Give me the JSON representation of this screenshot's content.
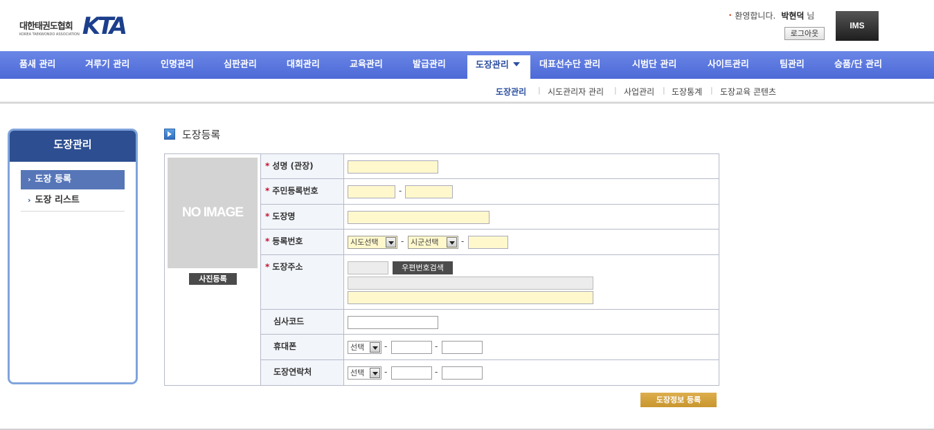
{
  "header": {
    "logo_kr": "대한태권도협회",
    "logo_en": "KOREA TAEKWONDO ASSOCIATION",
    "logo_mark": "KTA",
    "welcome": "환영합니다.",
    "user_name": "박현덕",
    "user_suffix": "님",
    "logout_label": "로그아웃",
    "ims_label": "IMS"
  },
  "main_nav": [
    {
      "label": "품새 관리"
    },
    {
      "label": "겨루기 관리"
    },
    {
      "label": "인명관리"
    },
    {
      "label": "심판관리"
    },
    {
      "label": "대회관리"
    },
    {
      "label": "교육관리"
    },
    {
      "label": "발급관리"
    },
    {
      "label": "도장관리"
    },
    {
      "label": "대표선수단 관리"
    },
    {
      "label": "시범단 관리"
    },
    {
      "label": "사이트관리"
    },
    {
      "label": "팀관리"
    },
    {
      "label": "승품/단 관리"
    }
  ],
  "sub_nav": [
    {
      "label": "도장관리"
    },
    {
      "label": "시도관리자 관리"
    },
    {
      "label": "사업관리"
    },
    {
      "label": "도장통계"
    },
    {
      "label": "도장교육 콘텐츠"
    }
  ],
  "side": {
    "title": "도장관리",
    "items": [
      {
        "label": "도장 등록"
      },
      {
        "label": "도장 리스트"
      }
    ]
  },
  "section_title": "도장등록",
  "form": {
    "photo_placeholder": "NO IMAGE",
    "photo_button": "사진등록",
    "required_mark": "*",
    "rows": {
      "name": {
        "label": "성명 (관장)"
      },
      "rrn": {
        "label": "주민등록번호"
      },
      "dojang_name": {
        "label": "도장명"
      },
      "reg_no": {
        "label": "등록번호",
        "sido": "시도선택",
        "sigun": "시군선택"
      },
      "address": {
        "label": "도장주소",
        "zip_button": "우편번호검색"
      },
      "exam_code": {
        "label": "심사코드"
      },
      "mobile": {
        "label": "휴대폰",
        "select": "선택"
      },
      "contact": {
        "label": "도장연락처",
        "select": "선택"
      }
    },
    "dash": "-",
    "submit_label": "도장정보 등록"
  }
}
